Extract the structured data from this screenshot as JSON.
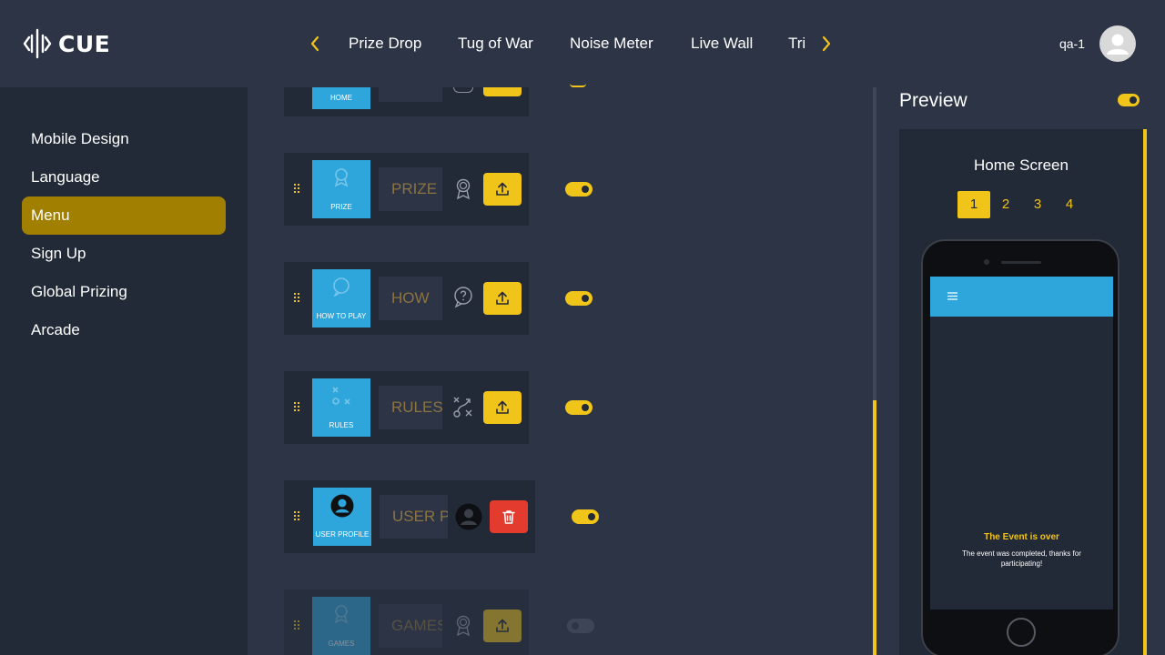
{
  "app": {
    "logo_text": "CUE"
  },
  "nav": {
    "tabs": [
      "Prize Drop",
      "Tug of War",
      "Noise Meter",
      "Live Wall",
      "Trivia"
    ]
  },
  "user": {
    "name": "qa-1"
  },
  "sidebar": {
    "items": [
      {
        "label": "Mobile Design",
        "active": false
      },
      {
        "label": "Language",
        "active": false
      },
      {
        "label": "Menu",
        "active": true
      },
      {
        "label": "Sign Up",
        "active": false
      },
      {
        "label": "Global Prizing",
        "active": false
      },
      {
        "label": "Arcade",
        "active": false
      }
    ]
  },
  "menu_items": [
    {
      "tile_label": "HOME",
      "field_value": "",
      "icon": "home-icon",
      "enabled": true
    },
    {
      "tile_label": "PRIZE",
      "field_value": "PRIZE",
      "icon": "award-ribbon-icon",
      "enabled": true
    },
    {
      "tile_label": "HOW TO PLAY",
      "field_value": "HOW",
      "icon": "question-bubble-icon",
      "enabled": true
    },
    {
      "tile_label": "RULES",
      "field_value": "RULES",
      "icon": "strategy-icon",
      "enabled": true
    },
    {
      "tile_label": "USER PROFILE",
      "field_value": "USER PROFILE",
      "icon": "user-circle-icon",
      "enabled": true
    },
    {
      "tile_label": "GAMES",
      "field_value": "GAMES",
      "icon": "award-ribbon-icon",
      "enabled": false
    }
  ],
  "preview": {
    "title": "Preview",
    "enabled": true,
    "screen_title": "Home Screen",
    "pages": [
      "1",
      "2",
      "3",
      "4"
    ],
    "active_page": "1",
    "event_title": "The Event is over",
    "event_message": "The event was completed, thanks for participating!"
  },
  "colors": {
    "accent": "#f0c419",
    "tile": "#2ea6dc",
    "background": "#2c3446",
    "panel": "#222937",
    "sidebar_active": "#a17f00",
    "delete": "#e33b2e"
  }
}
